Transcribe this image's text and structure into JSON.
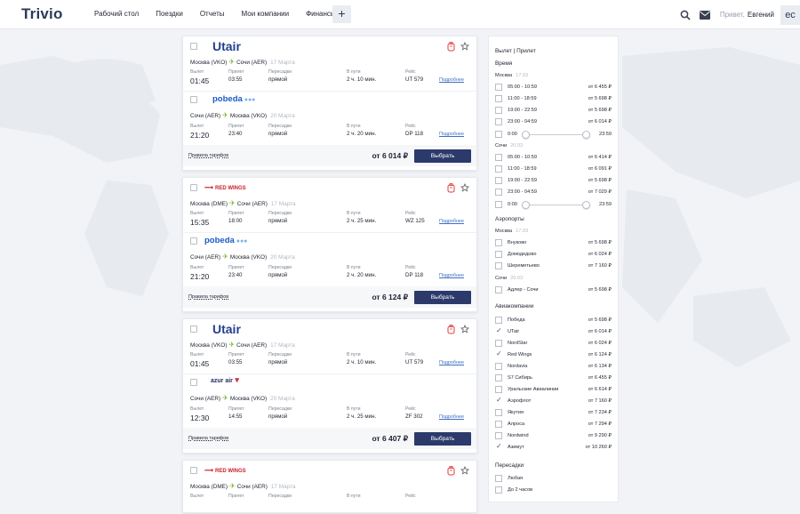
{
  "app": {
    "logo": "Trivio"
  },
  "nav": {
    "items": [
      "Рабочий стол",
      "Поездки",
      "Отчеты",
      "Мои компании",
      "Финансы"
    ],
    "plus": "+"
  },
  "user": {
    "greeting": "Привет,",
    "name": "Евгений",
    "initials": "ec"
  },
  "labels": {
    "depart": "Вылет",
    "arrive": "Прилет",
    "transfers": "Пересадки",
    "enroute": "В пути",
    "flight": "Рейс",
    "details": "Подробнее",
    "rules": "Правила тарифов",
    "choose": "Выбрать"
  },
  "cards": [
    {
      "segments": [
        {
          "airline": "Utair",
          "from": "Москва (VKO)",
          "to": "Сочи (AER)",
          "date": "17 Марта",
          "dep": "01:45",
          "arr": "03:55",
          "transfers": "прямой",
          "duration": "2 ч. 10 мин.",
          "flight": "UT 579"
        },
        {
          "airline": "pobeda",
          "from": "Сочи (AER)",
          "to": "Москва (VKO)",
          "date": "20 Марта",
          "dep": "21:20",
          "arr": "23:40",
          "transfers": "прямой",
          "duration": "2 ч. 20 мин.",
          "flight": "DP 118"
        }
      ],
      "price": "от 6 014 ₽"
    },
    {
      "segments": [
        {
          "airline": "RED WINGS",
          "from": "Москва (DME)",
          "to": "Сочи (AER)",
          "date": "17 Марта",
          "dep": "15:35",
          "arr": "18:00",
          "transfers": "прямой",
          "duration": "2 ч. 25 мин.",
          "flight": "WZ 125"
        },
        {
          "airline": "pobeda",
          "from": "Сочи (AER)",
          "to": "Москва (VKO)",
          "date": "20 Марта",
          "dep": "21:20",
          "arr": "23:40",
          "transfers": "прямой",
          "duration": "2 ч. 20 мин.",
          "flight": "DP 118"
        }
      ],
      "price": "от 6 124 ₽"
    },
    {
      "segments": [
        {
          "airline": "Utair",
          "from": "Москва (VKO)",
          "to": "Сочи (AER)",
          "date": "17 Марта",
          "dep": "01:45",
          "arr": "03:55",
          "transfers": "прямой",
          "duration": "2 ч. 10 мин.",
          "flight": "UT 579"
        },
        {
          "airline": "azur air",
          "from": "Сочи (AER)",
          "to": "Москва (VKO)",
          "date": "20 Марта",
          "dep": "12:30",
          "arr": "14:55",
          "transfers": "прямой",
          "duration": "2 ч. 25 мин.",
          "flight": "ZF 302"
        }
      ],
      "price": "от 6 407 ₽"
    },
    {
      "segments": [
        {
          "airline": "RED WINGS",
          "from": "Москва (DME)",
          "to": "Сочи (AER)",
          "date": "17 Марта",
          "dep": "",
          "arr": "",
          "transfers": "",
          "duration": "",
          "flight": ""
        }
      ],
      "price": ""
    }
  ],
  "filters": {
    "head": "Вылет | Прилет",
    "time_title": "Время",
    "city1": "Москва",
    "city1_date": "17.03",
    "city2": "Сочи",
    "city2_date": "20.03",
    "times1": [
      {
        "t": "05:00 - 10:59",
        "p": "от 6 455 ₽"
      },
      {
        "t": "11:00 - 18:59",
        "p": "от 5 698 ₽"
      },
      {
        "t": "19:00 - 22:59",
        "p": "от 5 698 ₽"
      },
      {
        "t": "23:00 - 04:59",
        "p": "от 6 014 ₽"
      }
    ],
    "times2": [
      {
        "t": "05:00 - 10:59",
        "p": "от 6 414 ₽"
      },
      {
        "t": "11:00 - 18:59",
        "p": "от 6 091 ₽"
      },
      {
        "t": "19:00 - 22:59",
        "p": "от 5 698 ₽"
      },
      {
        "t": "23:00 - 04:59",
        "p": "от 7 029 ₽"
      }
    ],
    "slider_min": "0:00",
    "slider_max": "23:59",
    "airports_title": "Аэропорты",
    "airports1": [
      {
        "t": "Внуково",
        "p": "от 5 698 ₽"
      },
      {
        "t": "Домодедово",
        "p": "от 6 024 ₽"
      },
      {
        "t": "Шереметьево",
        "p": "от 7 160 ₽"
      }
    ],
    "airports2": [
      {
        "t": "Адлер - Сочи",
        "p": "от 5 698 ₽"
      }
    ],
    "airlines_title": "Авиакомпании",
    "airlines": [
      {
        "t": "Победа",
        "p": "от 5 698 ₽",
        "c": false
      },
      {
        "t": "UTair",
        "p": "от 6 014 ₽",
        "c": true
      },
      {
        "t": "NordStar",
        "p": "от 6 024 ₽",
        "c": false
      },
      {
        "t": "Red Wings",
        "p": "от 6 124 ₽",
        "c": true
      },
      {
        "t": "Nordavia",
        "p": "от 6 134 ₽",
        "c": false
      },
      {
        "t": "S7 Сибирь",
        "p": "от 6 455 ₽",
        "c": false
      },
      {
        "t": "Уральские Авиалинии",
        "p": "от 6 614 ₽",
        "c": false
      },
      {
        "t": "Аэрофлот",
        "p": "от 7 160 ₽",
        "c": true
      },
      {
        "t": "Якутия",
        "p": "от 7 234 ₽",
        "c": false
      },
      {
        "t": "Алроса",
        "p": "от 7 294 ₽",
        "c": false
      },
      {
        "t": "Nordwind",
        "p": "от 9 290 ₽",
        "c": false
      },
      {
        "t": "Азимут",
        "p": "от 10 260 ₽",
        "c": true
      }
    ],
    "transfers_title": "Пересадки",
    "transfers": [
      "Любая",
      "До 2 часов"
    ]
  }
}
